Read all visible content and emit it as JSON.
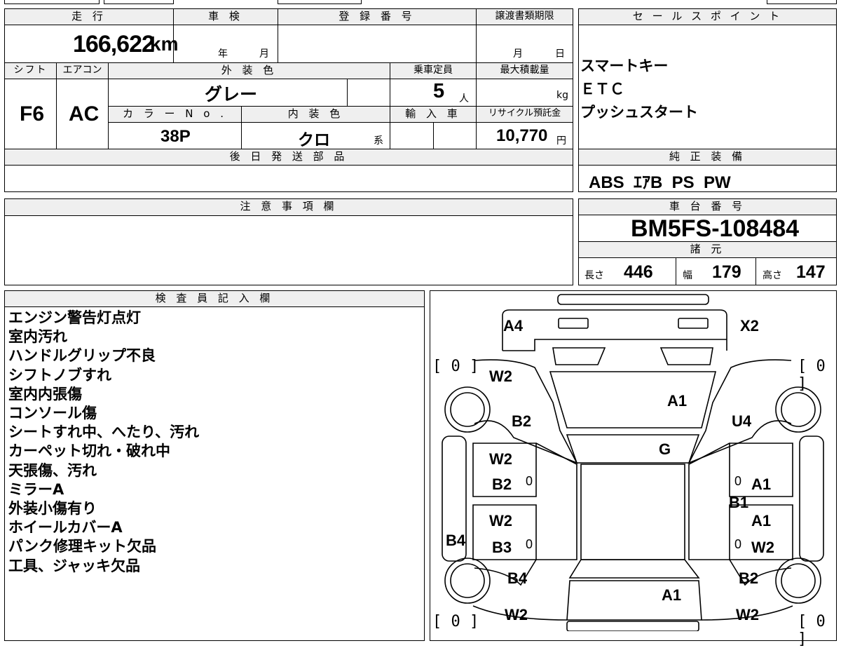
{
  "vehicle": {
    "labels": {
      "mileage": "走 行",
      "shaken": "車 検",
      "registration": "登 録 番 号",
      "transfer_deadline": "譲渡書類期限",
      "shift": "シフト",
      "aircon": "エアコン",
      "exterior_color": "外 装 色",
      "capacity": "乗車定員",
      "max_load": "最大積載量",
      "color_no": "カ ラ ー N o .",
      "interior_color": "内 装 色",
      "import": "輸 入 車",
      "recycle_fee": "リサイクル預託金",
      "later_parts": "後 日 発 送 部 品",
      "caution": "注 意 事 項 欄",
      "inspector": "検 査 員 記 入 欄",
      "sales_points": "セ ー ル ス ポ イ ン ト",
      "genuine_equipment": "純 正 装 備",
      "chassis_no": "車 台 番 号",
      "specs": "諸 元"
    },
    "mileage": "166,622",
    "mileage_unit": "km",
    "year_unit": "年",
    "month_unit": "月",
    "deadline_month": "月",
    "deadline_day": "日",
    "shift": "F6",
    "aircon": "AC",
    "exterior_color": "グレー",
    "capacity": "5",
    "capacity_unit": "人",
    "load_unit": "kg",
    "color_no": "38P",
    "interior_color": "クロ",
    "interior_suffix": "系",
    "recycle_fee": "10,770",
    "recycle_unit": "円",
    "chassis_no": "BM5FS-108484",
    "length_label": "長さ",
    "length": "446",
    "width_label": "幅",
    "width": "179",
    "height_label": "高さ",
    "height": "147",
    "genuine_equipment": "ABS  ｴｱB  PS  PW"
  },
  "sales_points": [
    "スマートキー",
    "ＥＴＣ",
    "プッシュスタート"
  ],
  "inspector_notes": [
    "エンジン警告灯点灯",
    "室内汚れ",
    "ハンドルグリップ不良",
    "シフトノブすれ",
    "室内内張傷",
    "コンソール傷",
    "シートすれ中、へたり、汚れ",
    "カーペット切れ・破れ中",
    "天張傷、汚れ",
    "ミラーA",
    "外装小傷有り",
    "ホイールカバーA",
    "パンク修理キット欠品",
    "工具、ジャッキ欠品"
  ],
  "damage_map": {
    "front_left": "A4",
    "front_right": "X2",
    "left_fender_top": "W2",
    "hood": "A1",
    "left_fender": "B2",
    "right_fender": "U4",
    "windshield": "G",
    "left_front_door_1": "W2",
    "left_front_door_2": "B2",
    "right_front_door": "A1",
    "right_pillar": "B1",
    "left_rear_door_1": "W2",
    "left_rear_door_2": "B3",
    "right_rear_door_1": "A1",
    "right_rear_door_2": "W2",
    "left_sill": "B4",
    "left_quarter": "B4",
    "right_quarter": "B2",
    "trunk": "A1",
    "rear_left": "W2",
    "rear_right": "W2",
    "zero": "0",
    "tire_fl": "[ 0 ]",
    "tire_fr": "[ 0 ]",
    "tire_rl": "[ 0 ]",
    "tire_rr": "[ 0 ]"
  }
}
